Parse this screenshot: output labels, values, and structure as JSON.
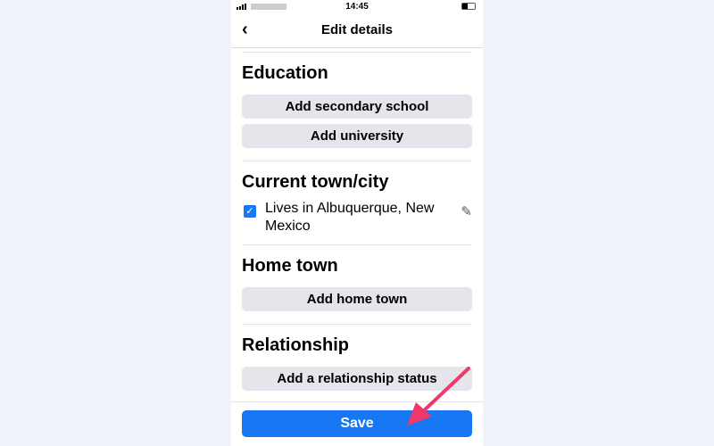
{
  "status": {
    "time": "14:45"
  },
  "header": {
    "title": "Edit details",
    "back_icon": "chevron-left-icon"
  },
  "sections": {
    "education": {
      "title": "Education",
      "buttons": [
        "Add secondary school",
        "Add university"
      ]
    },
    "current_city": {
      "title": "Current town/city",
      "value": "Lives in Albuquerque, New Mexico",
      "checked": true
    },
    "home_town": {
      "title": "Home town",
      "button": "Add home town"
    },
    "relationship": {
      "title": "Relationship",
      "button": "Add a relationship status"
    }
  },
  "footer": {
    "save_label": "Save"
  },
  "colors": {
    "accent": "#1877f2",
    "annotation_arrow": "#f0386b"
  }
}
